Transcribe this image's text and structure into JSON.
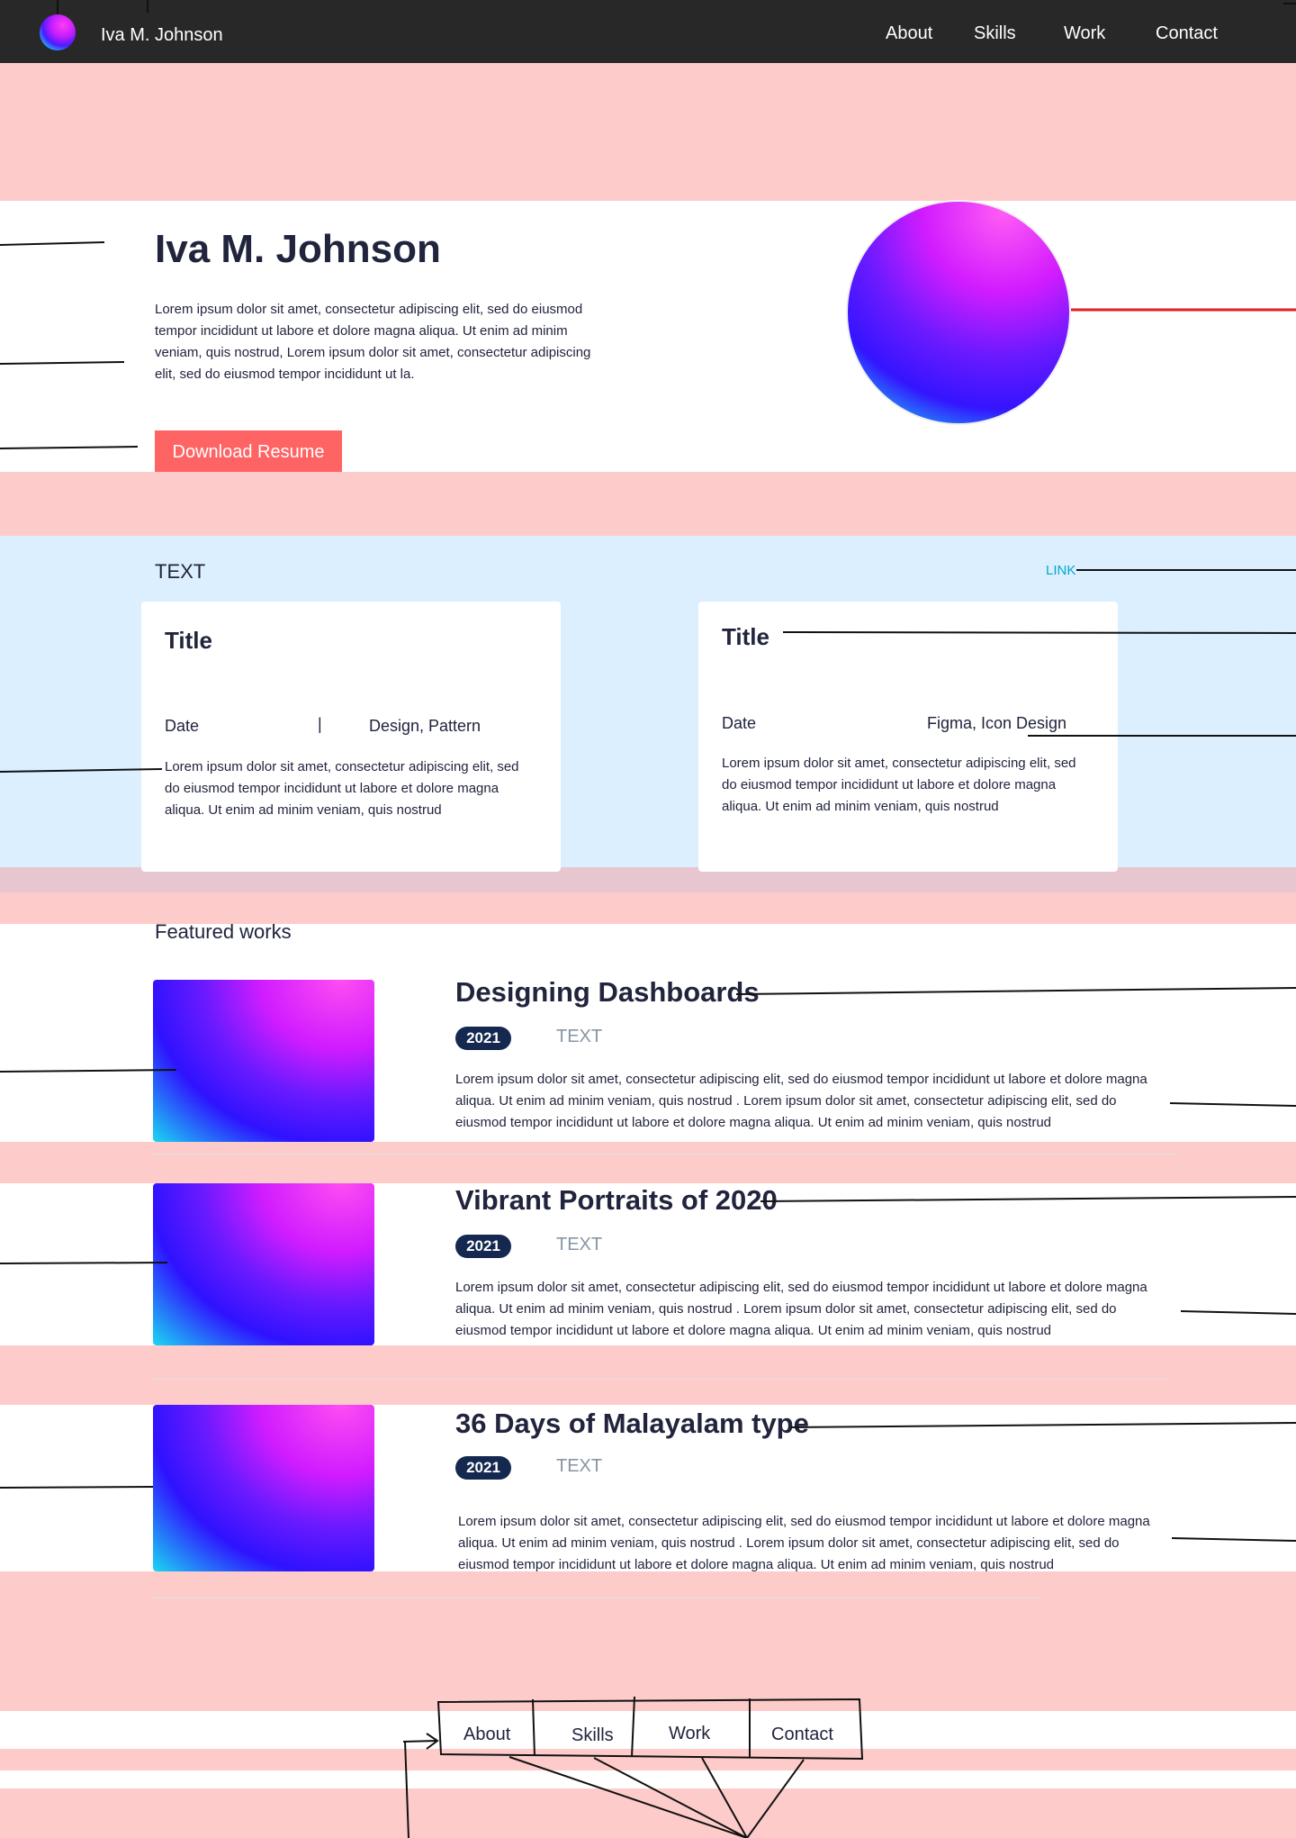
{
  "nav": {
    "brand": "Iva M. Johnson",
    "links": [
      "About",
      "Skills",
      "Work",
      "Contact"
    ]
  },
  "hero": {
    "title": "Iva M. Johnson",
    "text": "Lorem ipsum dolor sit amet, consectetur adipiscing elit, sed do eiusmod tempor incididunt ut labore et dolore magna aliqua. Ut enim ad minim veniam, quis nostrud, Lorem ipsum dolor sit amet, consectetur adipiscing elit, sed do eiusmod tempor incididunt ut la.",
    "button": "Download Resume"
  },
  "posts": {
    "label": "TEXT",
    "link": "LINK",
    "cards": [
      {
        "title": "Title",
        "date": "Date",
        "divider": "|",
        "tags": "Design, Pattern",
        "text": "Lorem ipsum dolor sit amet, consectetur adipiscing elit, sed do eiusmod tempor incididunt ut labore et dolore magna aliqua. Ut enim ad minim veniam, quis nostrud"
      },
      {
        "title": "Title",
        "date": "Date",
        "tags": "Figma, Icon Design",
        "text": "Lorem ipsum dolor sit amet, consectetur adipiscing elit, sed do eiusmod tempor incididunt ut labore et dolore magna aliqua. Ut enim ad minim veniam, quis nostrud"
      }
    ]
  },
  "featured": {
    "label": "Featured works",
    "items": [
      {
        "title": "Designing Dashboards",
        "year": "2021",
        "tag": "TEXT",
        "text": "Lorem ipsum dolor sit amet, consectetur adipiscing elit, sed do eiusmod tempor incididunt ut labore et dolore magna aliqua. Ut enim ad minim veniam, quis nostrud . Lorem ipsum dolor sit amet, consectetur adipiscing elit, sed do eiusmod tempor incididunt ut labore et dolore magna aliqua. Ut enim ad minim veniam, quis nostrud"
      },
      {
        "title": "Vibrant Portraits of 2020",
        "year": "2021",
        "tag": "TEXT",
        "text": "Lorem ipsum dolor sit amet, consectetur adipiscing elit, sed do eiusmod tempor incididunt ut labore et dolore magna aliqua. Ut enim ad minim veniam, quis nostrud . Lorem ipsum dolor sit amet, consectetur adipiscing elit, sed do eiusmod tempor incididunt ut labore et dolore magna aliqua. Ut enim ad minim veniam, quis nostrud"
      },
      {
        "title": "36 Days of Malayalam type",
        "year": "2021",
        "tag": "TEXT",
        "text": "Lorem ipsum dolor sit amet, consectetur adipiscing elit, sed do eiusmod tempor incididunt ut labore et dolore magna aliqua. Ut enim ad minim veniam, quis nostrud . Lorem ipsum dolor sit amet, consectetur adipiscing elit, sed do eiusmod tempor incididunt ut labore et dolore magna aliqua. Ut enim ad minim veniam, quis nostrud"
      }
    ]
  },
  "footer": {
    "links": [
      "About",
      "Skills",
      "Work",
      "Contact"
    ]
  },
  "colors": {
    "nav_bg": "#282828",
    "accent_pink": "#fecbcb",
    "button": "#ff6464",
    "section_blue": "#dcefff",
    "badge_navy": "#142850",
    "link_cyan": "#00a8cc"
  }
}
